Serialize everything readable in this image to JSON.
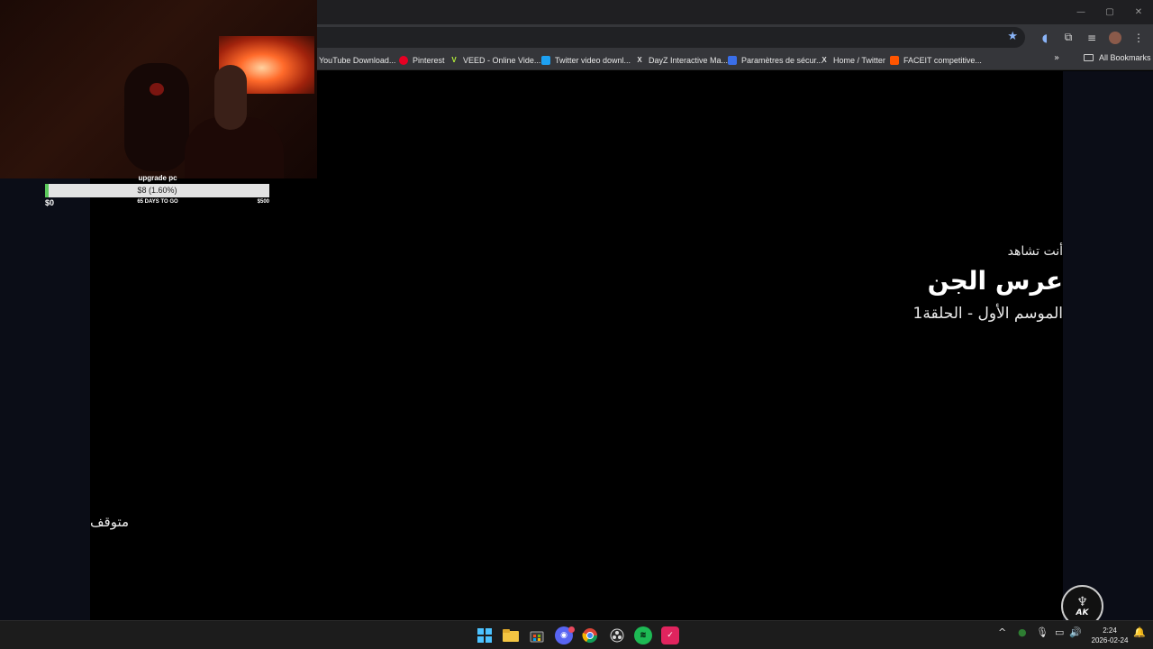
{
  "browser": {
    "window_controls": {
      "minimize": "—",
      "maximize": "▢",
      "close": "✕"
    },
    "bookmarks": [
      {
        "label": "YouTube Download...",
        "icon": "youtube-download-icon"
      },
      {
        "label": "Pinterest",
        "icon": "pinterest-icon"
      },
      {
        "label": "VEED - Online Vide...",
        "icon": "veed-icon"
      },
      {
        "label": "Twitter video downl...",
        "icon": "twitter-video-icon"
      },
      {
        "label": "DayZ Interactive Ma...",
        "icon": "dayz-icon"
      },
      {
        "label": "Paramètres de sécur...",
        "icon": "security-settings-icon"
      },
      {
        "label": "Home / Twitter",
        "icon": "x-icon"
      },
      {
        "label": "FACEIT competitive...",
        "icon": "faceit-icon"
      }
    ],
    "bookmarks_more": "»",
    "all_bookmarks": "All Bookmarks"
  },
  "player": {
    "now_watching": "أنت تشاهد",
    "title": "عرس الجن",
    "episode": "الموسم الأول  -  الحلقة1",
    "status": "متوقف"
  },
  "stream_overlay": {
    "goal": {
      "title": "upgrade pc",
      "progress_text": "$8 (1.60%)",
      "progress_fraction": 0.016,
      "min": "$0",
      "days_left": "65 DAYS TO GO",
      "max": "$500"
    },
    "logo_text": "AK"
  },
  "taskbar": {
    "apps": [
      "start-icon",
      "file-explorer-icon",
      "store-icon",
      "discord-icon",
      "chrome-icon",
      "obs-icon",
      "spotify-icon",
      "app-icon"
    ],
    "tray": {
      "chevron": "^",
      "mic": "🎙",
      "volume": "🔊"
    },
    "time": "2:24",
    "date": "2026-02-24"
  },
  "colors": {
    "goal_fill": "#5bc95b",
    "accent": "#8ab4f8"
  }
}
